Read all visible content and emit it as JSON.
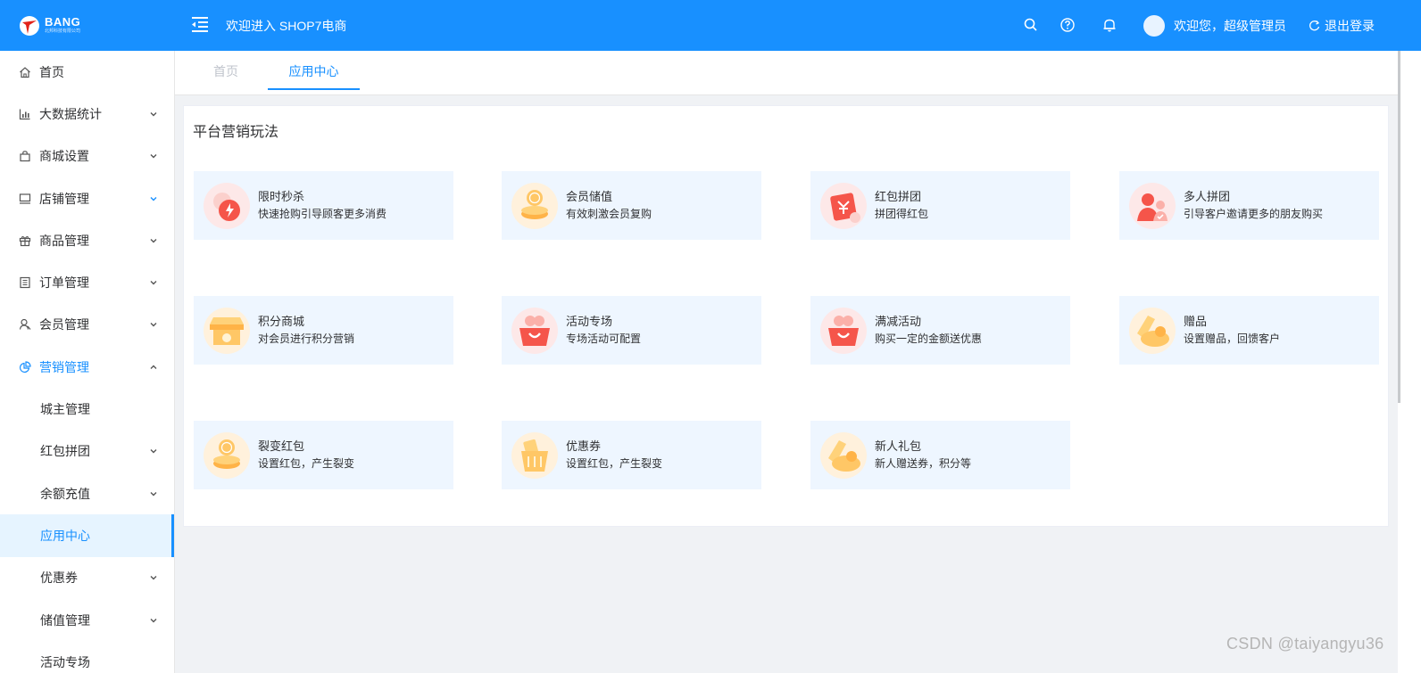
{
  "header": {
    "logo_name": "BANG",
    "logo_sub": "北邦科技有限公司",
    "title": "欢迎进入 SHOP7电商",
    "welcome": "欢迎您，超级管理员",
    "logout": "退出登录"
  },
  "sidebar": {
    "items": [
      {
        "label": "首页",
        "icon": "home-icon"
      },
      {
        "label": "大数据统计",
        "icon": "chart-icon"
      },
      {
        "label": "商城设置",
        "icon": "bag-icon"
      },
      {
        "label": "店铺管理",
        "icon": "monitor-icon"
      },
      {
        "label": "商品管理",
        "icon": "gift-icon"
      },
      {
        "label": "订单管理",
        "icon": "list-icon"
      },
      {
        "label": "会员管理",
        "icon": "user-icon"
      },
      {
        "label": "营销管理",
        "icon": "pie-icon"
      }
    ],
    "sub_items": [
      {
        "label": "城主管理"
      },
      {
        "label": "红包拼团"
      },
      {
        "label": "余额充值"
      },
      {
        "label": "应用中心"
      },
      {
        "label": "优惠券"
      },
      {
        "label": "储值管理"
      },
      {
        "label": "活动专场"
      }
    ]
  },
  "tabs": [
    {
      "label": "首页"
    },
    {
      "label": "应用中心"
    }
  ],
  "panel": {
    "title": "平台营销玩法",
    "cards": [
      {
        "name": "限时秒杀",
        "desc": "快速抢购引导顾客更多消费",
        "icon": "flash-sale-icon"
      },
      {
        "name": "会员储值",
        "desc": "有效刺激会员复购",
        "icon": "coin-stack-icon"
      },
      {
        "name": "红包拼团",
        "desc": "拼团得红包",
        "icon": "red-envelope-icon"
      },
      {
        "name": "多人拼团",
        "desc": "引导客户邀请更多的朋友购买",
        "icon": "group-users-icon"
      },
      {
        "name": "积分商城",
        "desc": "对会员进行积分营销",
        "icon": "store-icon"
      },
      {
        "name": "活动专场",
        "desc": "专场活动可配置",
        "icon": "gift-basket-icon"
      },
      {
        "name": "满减活动",
        "desc": "购买一定的金额送优惠",
        "icon": "discount-basket-icon"
      },
      {
        "name": "赠品",
        "desc": "设置赠品，回馈客户",
        "icon": "gift-hand-icon"
      },
      {
        "name": "裂变红包",
        "desc": "设置红包，产生裂变",
        "icon": "coin-stack-icon"
      },
      {
        "name": "优惠券",
        "desc": "设置红包，产生裂变",
        "icon": "coupon-bag-icon"
      },
      {
        "name": "新人礼包",
        "desc": "新人赠送券，积分等",
        "icon": "gift-hand-icon"
      }
    ]
  },
  "watermark": "CSDN @taiyangyu36",
  "colors": {
    "primary": "#1890ff",
    "card_bg": "#eef6ff",
    "orange": "#ffb347",
    "red": "#f5554a"
  }
}
